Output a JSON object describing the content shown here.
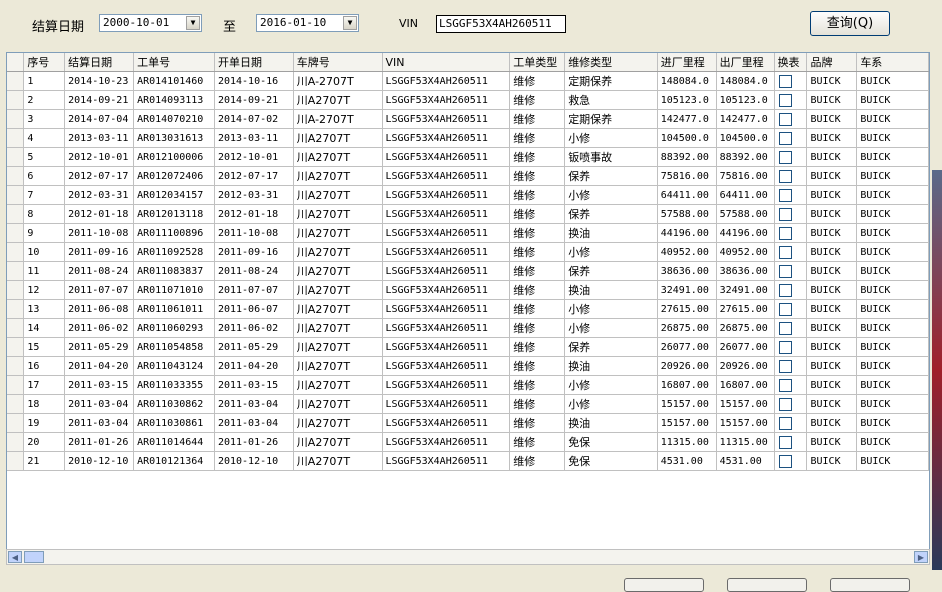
{
  "filters": {
    "date_label": "结算日期",
    "start_date": "2000-10-01",
    "to_label": "至",
    "end_date": "2016-01-10",
    "vin_label": "VIN",
    "vin_value": "LSGGF53X4AH260511",
    "query_button": "查询(Q)"
  },
  "table": {
    "columns": [
      "序号",
      "结算日期",
      "工单号",
      "开单日期",
      "车牌号",
      "VIN",
      "工单类型",
      "维修类型",
      "进厂里程",
      "出厂里程",
      "换表",
      "品牌",
      "车系"
    ],
    "rows": [
      [
        "1",
        "2014-10-23",
        "AR014101460",
        "2014-10-16",
        "川A-2707T",
        "LSGGF53X4AH260511",
        "维修",
        "定期保养",
        "148084.0",
        "148084.0",
        "",
        "BUICK",
        "BUICK"
      ],
      [
        "2",
        "2014-09-21",
        "AR014093113",
        "2014-09-21",
        "川A2707T",
        "LSGGF53X4AH260511",
        "维修",
        "救急",
        "105123.0",
        "105123.0",
        "",
        "BUICK",
        "BUICK"
      ],
      [
        "3",
        "2014-07-04",
        "AR014070210",
        "2014-07-02",
        "川A-2707T",
        "LSGGF53X4AH260511",
        "维修",
        "定期保养",
        "142477.0",
        "142477.0",
        "",
        "BUICK",
        "BUICK"
      ],
      [
        "4",
        "2013-03-11",
        "AR013031613",
        "2013-03-11",
        "川A2707T",
        "LSGGF53X4AH260511",
        "维修",
        "小修",
        "104500.0",
        "104500.0",
        "",
        "BUICK",
        "BUICK"
      ],
      [
        "5",
        "2012-10-01",
        "AR012100006",
        "2012-10-01",
        "川A2707T",
        "LSGGF53X4AH260511",
        "维修",
        "钣喷事故",
        "88392.00",
        "88392.00",
        "",
        "BUICK",
        "BUICK"
      ],
      [
        "6",
        "2012-07-17",
        "AR012072406",
        "2012-07-17",
        "川A2707T",
        "LSGGF53X4AH260511",
        "维修",
        "保养",
        "75816.00",
        "75816.00",
        "",
        "BUICK",
        "BUICK"
      ],
      [
        "7",
        "2012-03-31",
        "AR012034157",
        "2012-03-31",
        "川A2707T",
        "LSGGF53X4AH260511",
        "维修",
        "小修",
        "64411.00",
        "64411.00",
        "",
        "BUICK",
        "BUICK"
      ],
      [
        "8",
        "2012-01-18",
        "AR012013118",
        "2012-01-18",
        "川A2707T",
        "LSGGF53X4AH260511",
        "维修",
        "保养",
        "57588.00",
        "57588.00",
        "",
        "BUICK",
        "BUICK"
      ],
      [
        "9",
        "2011-10-08",
        "AR011100896",
        "2011-10-08",
        "川A2707T",
        "LSGGF53X4AH260511",
        "维修",
        "换油",
        "44196.00",
        "44196.00",
        "",
        "BUICK",
        "BUICK"
      ],
      [
        "10",
        "2011-09-16",
        "AR011092528",
        "2011-09-16",
        "川A2707T",
        "LSGGF53X4AH260511",
        "维修",
        "小修",
        "40952.00",
        "40952.00",
        "",
        "BUICK",
        "BUICK"
      ],
      [
        "11",
        "2011-08-24",
        "AR011083837",
        "2011-08-24",
        "川A2707T",
        "LSGGF53X4AH260511",
        "维修",
        "保养",
        "38636.00",
        "38636.00",
        "",
        "BUICK",
        "BUICK"
      ],
      [
        "12",
        "2011-07-07",
        "AR011071010",
        "2011-07-07",
        "川A2707T",
        "LSGGF53X4AH260511",
        "维修",
        "换油",
        "32491.00",
        "32491.00",
        "",
        "BUICK",
        "BUICK"
      ],
      [
        "13",
        "2011-06-08",
        "AR011061011",
        "2011-06-07",
        "川A2707T",
        "LSGGF53X4AH260511",
        "维修",
        "小修",
        "27615.00",
        "27615.00",
        "",
        "BUICK",
        "BUICK"
      ],
      [
        "14",
        "2011-06-02",
        "AR011060293",
        "2011-06-02",
        "川A2707T",
        "LSGGF53X4AH260511",
        "维修",
        "小修",
        "26875.00",
        "26875.00",
        "",
        "BUICK",
        "BUICK"
      ],
      [
        "15",
        "2011-05-29",
        "AR011054858",
        "2011-05-29",
        "川A2707T",
        "LSGGF53X4AH260511",
        "维修",
        "保养",
        "26077.00",
        "26077.00",
        "",
        "BUICK",
        "BUICK"
      ],
      [
        "16",
        "2011-04-20",
        "AR011043124",
        "2011-04-20",
        "川A2707T",
        "LSGGF53X4AH260511",
        "维修",
        "换油",
        "20926.00",
        "20926.00",
        "",
        "BUICK",
        "BUICK"
      ],
      [
        "17",
        "2011-03-15",
        "AR011033355",
        "2011-03-15",
        "川A2707T",
        "LSGGF53X4AH260511",
        "维修",
        "小修",
        "16807.00",
        "16807.00",
        "",
        "BUICK",
        "BUICK"
      ],
      [
        "18",
        "2011-03-04",
        "AR011030862",
        "2011-03-04",
        "川A2707T",
        "LSGGF53X4AH260511",
        "维修",
        "小修",
        "15157.00",
        "15157.00",
        "",
        "BUICK",
        "BUICK"
      ],
      [
        "19",
        "2011-03-04",
        "AR011030861",
        "2011-03-04",
        "川A2707T",
        "LSGGF53X4AH260511",
        "维修",
        "换油",
        "15157.00",
        "15157.00",
        "",
        "BUICK",
        "BUICK"
      ],
      [
        "20",
        "2011-01-26",
        "AR011014644",
        "2011-01-26",
        "川A2707T",
        "LSGGF53X4AH260511",
        "维修",
        "免保",
        "11315.00",
        "11315.00",
        "",
        "BUICK",
        "BUICK"
      ],
      [
        "21",
        "2010-12-10",
        "AR010121364",
        "2010-12-10",
        "川A2707T",
        "LSGGF53X4AH260511",
        "维修",
        "免保",
        "4531.00",
        "4531.00",
        "",
        "BUICK",
        "BUICK"
      ]
    ]
  }
}
